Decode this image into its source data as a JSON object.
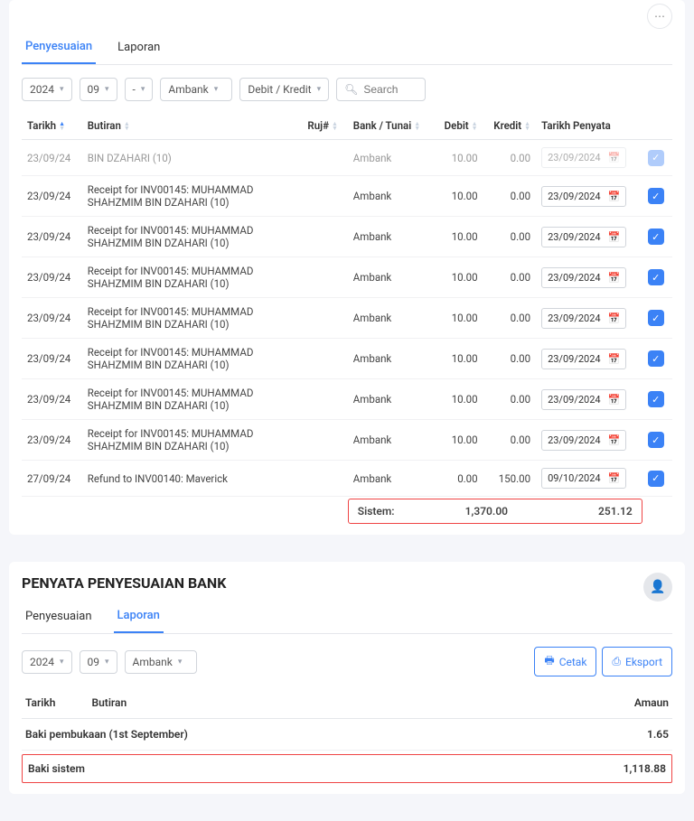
{
  "panel1": {
    "tabs": {
      "penyesuaian": "Penyesuaian",
      "laporan": "Laporan"
    },
    "filters": {
      "year": "2024",
      "month": "09",
      "dash": "-",
      "bank": "Ambank",
      "debitkredit": "Debit / Kredit",
      "search_placeholder": "Search"
    },
    "headers": {
      "tarikh": "Tarikh",
      "butiran": "Butiran",
      "ruj": "Ruj#",
      "banktunai": "Bank / Tunai",
      "debit": "Debit",
      "kredit": "Kredit",
      "tarikh_penyata": "Tarikh Penyata"
    },
    "rows": [
      {
        "tarikh": "23/09/24",
        "butiran": "BIN DZAHARI (10)",
        "bank": "Ambank",
        "debit": "10.00",
        "kredit": "0.00",
        "penyata": "23/09/2024",
        "dim": true
      },
      {
        "tarikh": "23/09/24",
        "butiran": "Receipt for INV00145: MUHAMMAD SHAHZMIM BIN DZAHARI (10)",
        "bank": "Ambank",
        "debit": "10.00",
        "kredit": "0.00",
        "penyata": "23/09/2024"
      },
      {
        "tarikh": "23/09/24",
        "butiran": "Receipt for INV00145: MUHAMMAD SHAHZMIM BIN DZAHARI (10)",
        "bank": "Ambank",
        "debit": "10.00",
        "kredit": "0.00",
        "penyata": "23/09/2024"
      },
      {
        "tarikh": "23/09/24",
        "butiran": "Receipt for INV00145: MUHAMMAD SHAHZMIM BIN DZAHARI (10)",
        "bank": "Ambank",
        "debit": "10.00",
        "kredit": "0.00",
        "penyata": "23/09/2024"
      },
      {
        "tarikh": "23/09/24",
        "butiran": "Receipt for INV00145: MUHAMMAD SHAHZMIM BIN DZAHARI (10)",
        "bank": "Ambank",
        "debit": "10.00",
        "kredit": "0.00",
        "penyata": "23/09/2024"
      },
      {
        "tarikh": "23/09/24",
        "butiran": "Receipt for INV00145: MUHAMMAD SHAHZMIM BIN DZAHARI (10)",
        "bank": "Ambank",
        "debit": "10.00",
        "kredit": "0.00",
        "penyata": "23/09/2024"
      },
      {
        "tarikh": "23/09/24",
        "butiran": "Receipt for INV00145: MUHAMMAD SHAHZMIM BIN DZAHARI (10)",
        "bank": "Ambank",
        "debit": "10.00",
        "kredit": "0.00",
        "penyata": "23/09/2024"
      },
      {
        "tarikh": "23/09/24",
        "butiran": "Receipt for INV00145: MUHAMMAD SHAHZMIM BIN DZAHARI (10)",
        "bank": "Ambank",
        "debit": "10.00",
        "kredit": "0.00",
        "penyata": "23/09/2024"
      },
      {
        "tarikh": "27/09/24",
        "butiran": "Refund to INV00140: Maverick",
        "bank": "Ambank",
        "debit": "0.00",
        "kredit": "150.00",
        "penyata": "09/10/2024"
      }
    ],
    "totals": {
      "label": "Sistem:",
      "debit": "1,370.00",
      "kredit": "251.12"
    }
  },
  "panel2": {
    "title": "PENYATA PENYESUAIAN BANK",
    "tabs": {
      "penyesuaian": "Penyesuaian",
      "laporan": "Laporan"
    },
    "filters": {
      "year": "2024",
      "month": "09",
      "bank": "Ambank"
    },
    "buttons": {
      "cetak": "Cetak",
      "eksport": "Eksport"
    },
    "headers": {
      "tarikh": "Tarikh",
      "butiran": "Butiran",
      "amaun": "Amaun"
    },
    "rows": [
      {
        "butiran": "Baki pembukaan (1st September)",
        "amaun": "1.65",
        "bold": true
      },
      {
        "butiran": "Baki sistem",
        "amaun": "1,118.88",
        "bold": true,
        "highlight": true
      }
    ]
  }
}
